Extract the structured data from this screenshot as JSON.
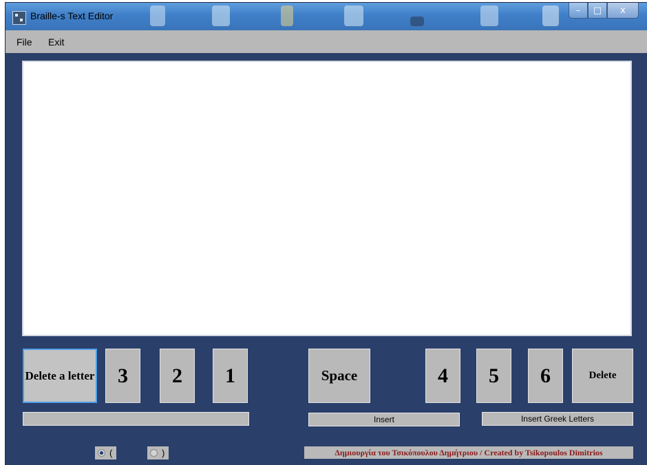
{
  "window": {
    "title": "Braille-s Text Editor"
  },
  "window_controls": {
    "minimize": "–",
    "maximize": "□",
    "close": "x"
  },
  "menu": {
    "file": "File",
    "exit": "Exit"
  },
  "editor": {
    "text": ""
  },
  "buttons": {
    "delete_letter": "Delete a letter",
    "dot3": "3",
    "dot2": "2",
    "dot1": "1",
    "space": "Space",
    "dot4": "4",
    "dot5": "5",
    "dot6": "6",
    "delete": "Delete"
  },
  "bars": {
    "left": "",
    "insert": "Insert",
    "insert_greek": "Insert Greek Letters"
  },
  "radios": [
    {
      "label": "(",
      "checked": true
    },
    {
      "label": ")",
      "checked": false
    }
  ],
  "credits": "Δημιουργία του Τσικόπουλου Δημήτριου / Created by Tsikopoulos Dimitrios",
  "colors": {
    "window_bg": "#2a3f6a",
    "button_bg": "#b9b9b9",
    "credits_text": "#8b1a1a",
    "title_bar": "#3f7fc8"
  }
}
